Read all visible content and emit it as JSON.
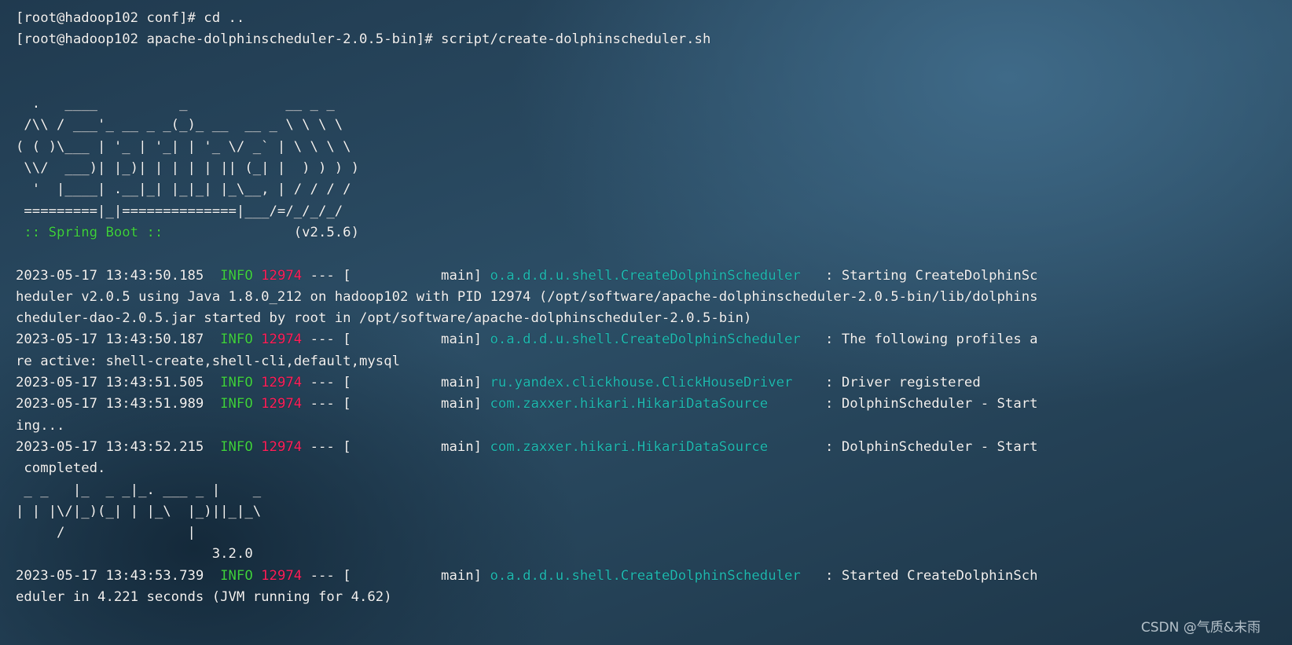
{
  "terminal": {
    "lines": [
      {
        "text": "[root@hadoop102 conf]# cd .."
      },
      {
        "text": "[root@hadoop102 apache-dolphinscheduler-2.0.5-bin]# script/create-dolphinscheduler.sh"
      },
      {
        "text": ""
      },
      {
        "text": ""
      },
      {
        "text": "  .   ____          _            __ _ _"
      },
      {
        "text": " /\\\\ / ___'_ __ _ _(_)_ __  __ _ \\ \\ \\ \\"
      },
      {
        "text": "( ( )\\___ | '_ | '_| | '_ \\/ _` | \\ \\ \\ \\"
      },
      {
        "text": " \\\\/  ___)| |_)| | | | | || (_| |  ) ) ) )"
      },
      {
        "text": "  '  |____| .__|_| |_|_| |_\\__, | / / / /"
      },
      {
        "text": " =========|_|==============|___/=/_/_/_/"
      },
      {
        "spring": " :: Spring Boot :: ",
        "text": "               (v2.5.6)"
      },
      {
        "text": ""
      },
      {
        "ts": "2023-05-17 13:43:50.185  ",
        "level": "INFO",
        "pid": " 12974",
        "thread": " --- [           main] ",
        "logger": "o.a.d.d.u.shell.CreateDolphinScheduler  ",
        "msg": " : Starting CreateDolphinSc"
      },
      {
        "text": "heduler v2.0.5 using Java 1.8.0_212 on hadoop102 with PID 12974 (/opt/software/apache-dolphinscheduler-2.0.5-bin/lib/dolphins"
      },
      {
        "text": "cheduler-dao-2.0.5.jar started by root in /opt/software/apache-dolphinscheduler-2.0.5-bin)"
      },
      {
        "ts": "2023-05-17 13:43:50.187  ",
        "level": "INFO",
        "pid": " 12974",
        "thread": " --- [           main] ",
        "logger": "o.a.d.d.u.shell.CreateDolphinScheduler  ",
        "msg": " : The following profiles a"
      },
      {
        "text": "re active: shell-create,shell-cli,default,mysql"
      },
      {
        "ts": "2023-05-17 13:43:51.505  ",
        "level": "INFO",
        "pid": " 12974",
        "thread": " --- [           main] ",
        "logger": "ru.yandex.clickhouse.ClickHouseDriver   ",
        "msg": " : Driver registered"
      },
      {
        "ts": "2023-05-17 13:43:51.989  ",
        "level": "INFO",
        "pid": " 12974",
        "thread": " --- [           main] ",
        "logger": "com.zaxxer.hikari.HikariDataSource      ",
        "msg": " : DolphinScheduler - Start"
      },
      {
        "text": "ing..."
      },
      {
        "ts": "2023-05-17 13:43:52.215  ",
        "level": "INFO",
        "pid": " 12974",
        "thread": " --- [           main] ",
        "logger": "com.zaxxer.hikari.HikariDataSource      ",
        "msg": " : DolphinScheduler - Start"
      },
      {
        "text": " completed."
      },
      {
        "text": " _ _   |_  _ _|_. ___ _ |    _"
      },
      {
        "text": "| | |\\/|_)(_| | |_\\  |_)||_|_\\"
      },
      {
        "text": "     /               |"
      },
      {
        "text": "                        3.2.0"
      },
      {
        "ts": "2023-05-17 13:43:53.739  ",
        "level": "INFO",
        "pid": " 12974",
        "thread": " --- [           main] ",
        "logger": "o.a.d.d.u.shell.CreateDolphinScheduler  ",
        "msg": " : Started CreateDolphinSch"
      },
      {
        "text": "eduler in 4.221 seconds (JVM running for 4.62)"
      }
    ]
  },
  "watermark": "CSDN @气质&末雨",
  "colors": {
    "info": "#3fd13f",
    "pid": "#ff1f5a",
    "logger": "#1fb8b0",
    "text": "#f2f2f2"
  }
}
